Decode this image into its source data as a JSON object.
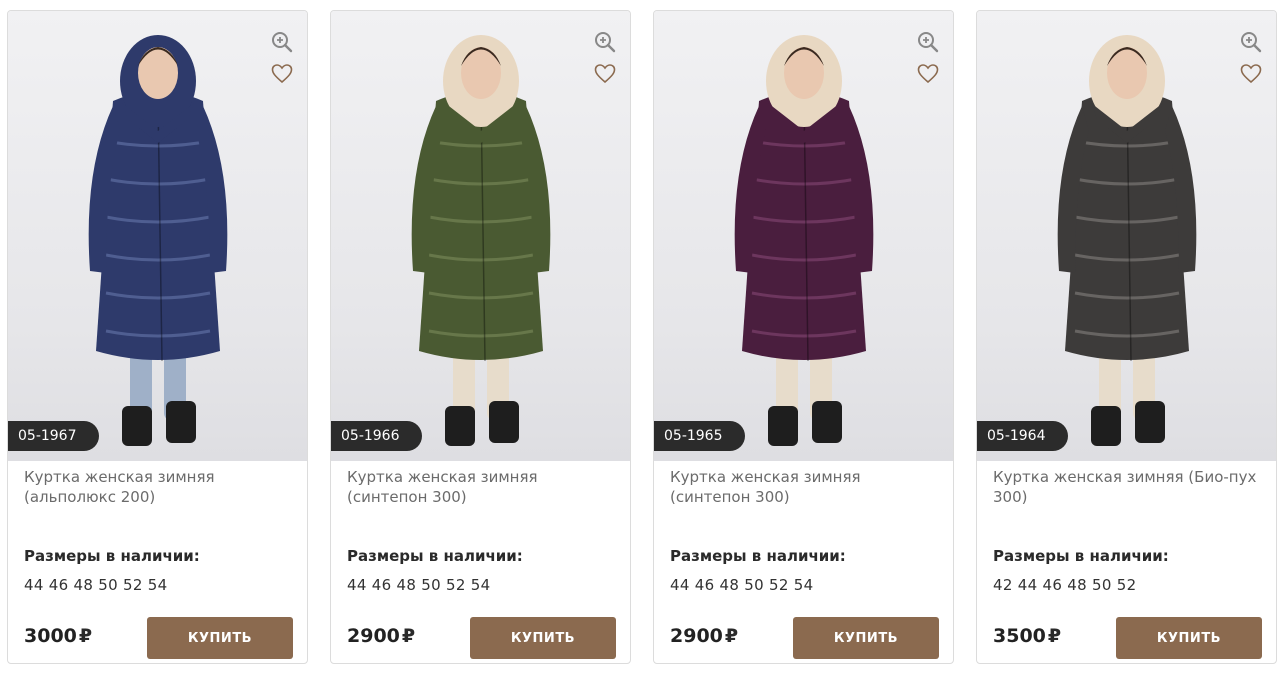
{
  "products": [
    {
      "sku": "05-1967",
      "title": "Куртка женская зимняя (альполюкс 200)",
      "sizes_label": "Размеры в наличии:",
      "sizes": "44 46 48 50 52 54",
      "price": "3000",
      "currency": "₽",
      "buy_label": "КУПИТЬ",
      "coat_color": "#2e3a6b",
      "coat_highlight": "#6b7bb0",
      "hood_color": "#2e3a6b"
    },
    {
      "sku": "05-1966",
      "title": "Куртка женская зимняя (синтепон 300)",
      "sizes_label": "Размеры в наличии:",
      "sizes": "44 46 48 50 52 54",
      "price": "2900",
      "currency": "₽",
      "buy_label": "КУПИТЬ",
      "coat_color": "#4a5a32",
      "coat_highlight": "#7f8f5e",
      "hood_color": "#e8d8c2"
    },
    {
      "sku": "05-1965",
      "title": "Куртка женская зимняя (синтепон 300)",
      "sizes_label": "Размеры в наличии:",
      "sizes": "44 46 48 50 52 54",
      "price": "2900",
      "currency": "₽",
      "buy_label": "КУПИТЬ",
      "coat_color": "#4a1e3e",
      "coat_highlight": "#8a4a78",
      "hood_color": "#e8d8c2"
    },
    {
      "sku": "05-1964",
      "title": "Куртка женская зимняя (Био-пух 300)",
      "sizes_label": "Размеры в наличии:",
      "sizes": "42 44 46 48 50 52",
      "price": "3500",
      "currency": "₽",
      "buy_label": "КУПИТЬ",
      "coat_color": "#3d3b3a",
      "coat_highlight": "#8a8784",
      "hood_color": "#e8d8c2"
    }
  ],
  "icons": {
    "zoom": "zoom-icon",
    "favorite": "heart-icon"
  },
  "colors": {
    "buy_button": "#8b6a4f",
    "sku_badge": "#2b2b2b"
  }
}
